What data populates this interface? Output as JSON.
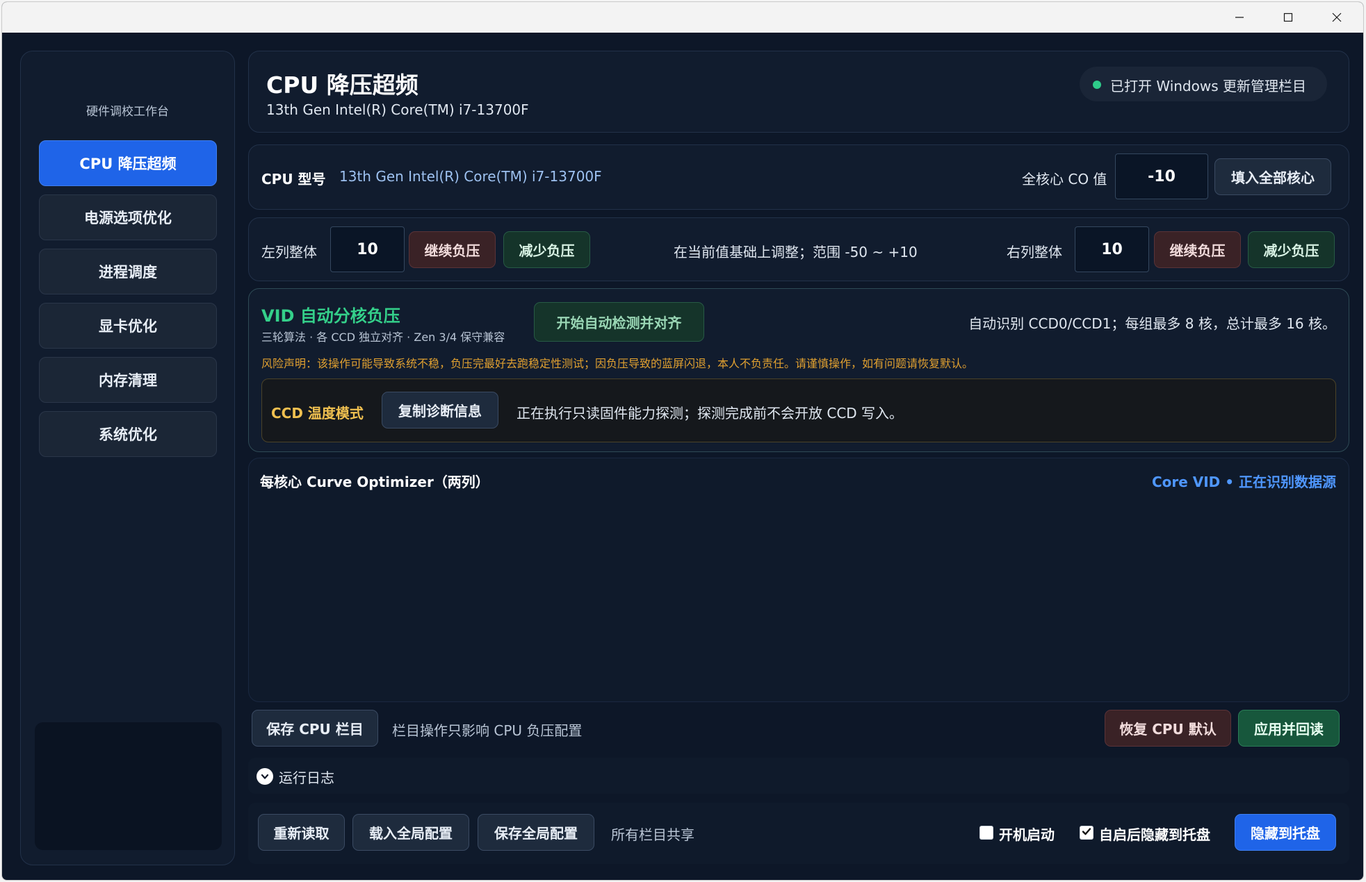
{
  "window": {
    "controls": [
      "minimize-icon",
      "maximize-icon",
      "close-icon"
    ]
  },
  "sidebar": {
    "app_name": "硬件调校工作台",
    "items": [
      {
        "label": "CPU 降压超频",
        "active": true
      },
      {
        "label": "电源选项优化",
        "active": false
      },
      {
        "label": "进程调度",
        "active": false
      },
      {
        "label": "显卡优化",
        "active": false
      },
      {
        "label": "内存清理",
        "active": false
      },
      {
        "label": "系统优化",
        "active": false
      }
    ]
  },
  "header": {
    "title": "CPU 降压超频",
    "subtitle": "13th Gen Intel(R) Core(TM) i7-13700F",
    "status_text": "已打开 Windows 更新管理栏目",
    "status_color": "#2ecc8a"
  },
  "cpu_row": {
    "model_label": "CPU 型号",
    "model_value": "13th Gen Intel(R) Core(TM) i7-13700F",
    "co_label": "全核心 CO 值",
    "co_value": "-10",
    "fill_button": "填入全部核心"
  },
  "column_row": {
    "left_label": "左列整体",
    "left_value": "10",
    "continue_label": "继续负压",
    "reduce_label": "减少负压",
    "hint": "在当前值基础上调整；范围 -50 ~ +10",
    "right_label": "右列整体",
    "right_value": "10"
  },
  "vid_panel": {
    "title": "VID 自动分核负压",
    "subtitle": "三轮算法 · 各 CCD 独立对齐 · Zen 3/4 保守兼容",
    "start_button": "开始自动检测并对齐",
    "auto_detect_info": "自动识别 CCD0/CCD1；每组最多 8 核，总计最多 16 核。",
    "risk_text": "风险声明：该操作可能导致系统不稳，负压完最好去跑稳定性测试；因负压导致的蓝屏闪退，本人不负责任。请谨慎操作，如有问题请恢复默认。",
    "ccd_mode_label": "CCD 温度模式",
    "copy_diag_button": "复制诊断信息",
    "probe_status": "正在执行只读固件能力探测；探测完成前不会开放 CCD 写入。"
  },
  "curve_panel": {
    "title": "每核心 Curve Optimizer（两列）",
    "source_status": "Core VID • 正在识别数据源"
  },
  "action_bar": {
    "save_button": "保存 CPU 栏目",
    "note": "栏目操作只影响 CPU 负压配置",
    "restore_button": "恢复 CPU 默认",
    "apply_button": "应用并回读"
  },
  "log": {
    "label": "运行日志"
  },
  "footer": {
    "reload_button": "重新读取",
    "load_global_button": "载入全局配置",
    "save_global_button": "保存全局配置",
    "shared_note": "所有栏目共享",
    "autostart_label": "开机启动",
    "autostart_checked": false,
    "hide_on_start_label": "自启后隐藏到托盘",
    "hide_on_start_checked": true,
    "hide_tray_button": "隐藏到托盘"
  },
  "colors": {
    "accent_blue": "#1f64e8",
    "vid_green": "#34d08a",
    "warning_orange": "#e0a030",
    "ccd_yellow": "#f0c050",
    "link_blue": "#4f97ff"
  }
}
